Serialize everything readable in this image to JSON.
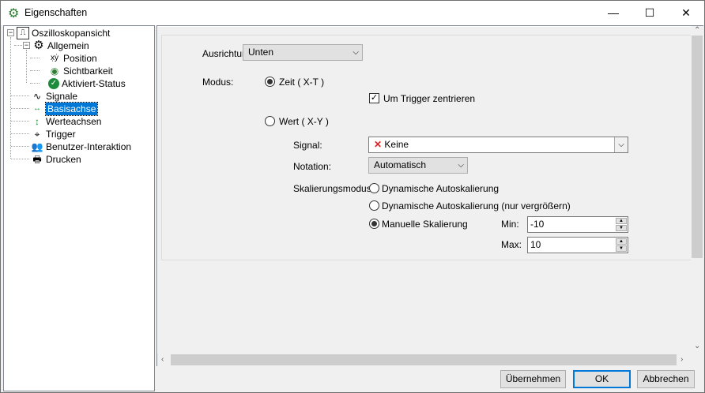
{
  "window": {
    "title": "Eigenschaften",
    "minimize": "—",
    "maximize": "☐",
    "close": "✕"
  },
  "tree": {
    "root": "Oszilloskopansicht",
    "allgemein": "Allgemein",
    "position": "Position",
    "sichtbarkeit": "Sichtbarkeit",
    "aktiviert": "Aktiviert-Status",
    "signale": "Signale",
    "basisachse": "Basisachse",
    "werteachsen": "Werteachsen",
    "trigger": "Trigger",
    "benutzer": "Benutzer-Interaktion",
    "drucken": "Drucken"
  },
  "form": {
    "ausrichtung_label": "Ausrichtung:",
    "ausrichtung_value": "Unten",
    "modus_label": "Modus:",
    "zeit": "Zeit ( X-T )",
    "zeit_selected": true,
    "trigger_center": "Um Trigger zentrieren",
    "trigger_center_checked": true,
    "wert": "Wert ( X-Y )",
    "signal_label": "Signal:",
    "signal_value": "Keine",
    "notation_label": "Notation:",
    "notation_value": "Automatisch",
    "skal_label": "Skalierungsmodus:",
    "skal_dyn": "Dynamische Autoskalierung",
    "skal_dyn_grow": "Dynamische Autoskalierung (nur vergrößern)",
    "skal_manual": "Manuelle Skalierung",
    "min_label": "Min:",
    "min_value": "-10",
    "max_label": "Max:",
    "max_value": "10"
  },
  "buttons": {
    "apply": "Übernehmen",
    "ok": "OK",
    "cancel": "Abbrechen"
  }
}
